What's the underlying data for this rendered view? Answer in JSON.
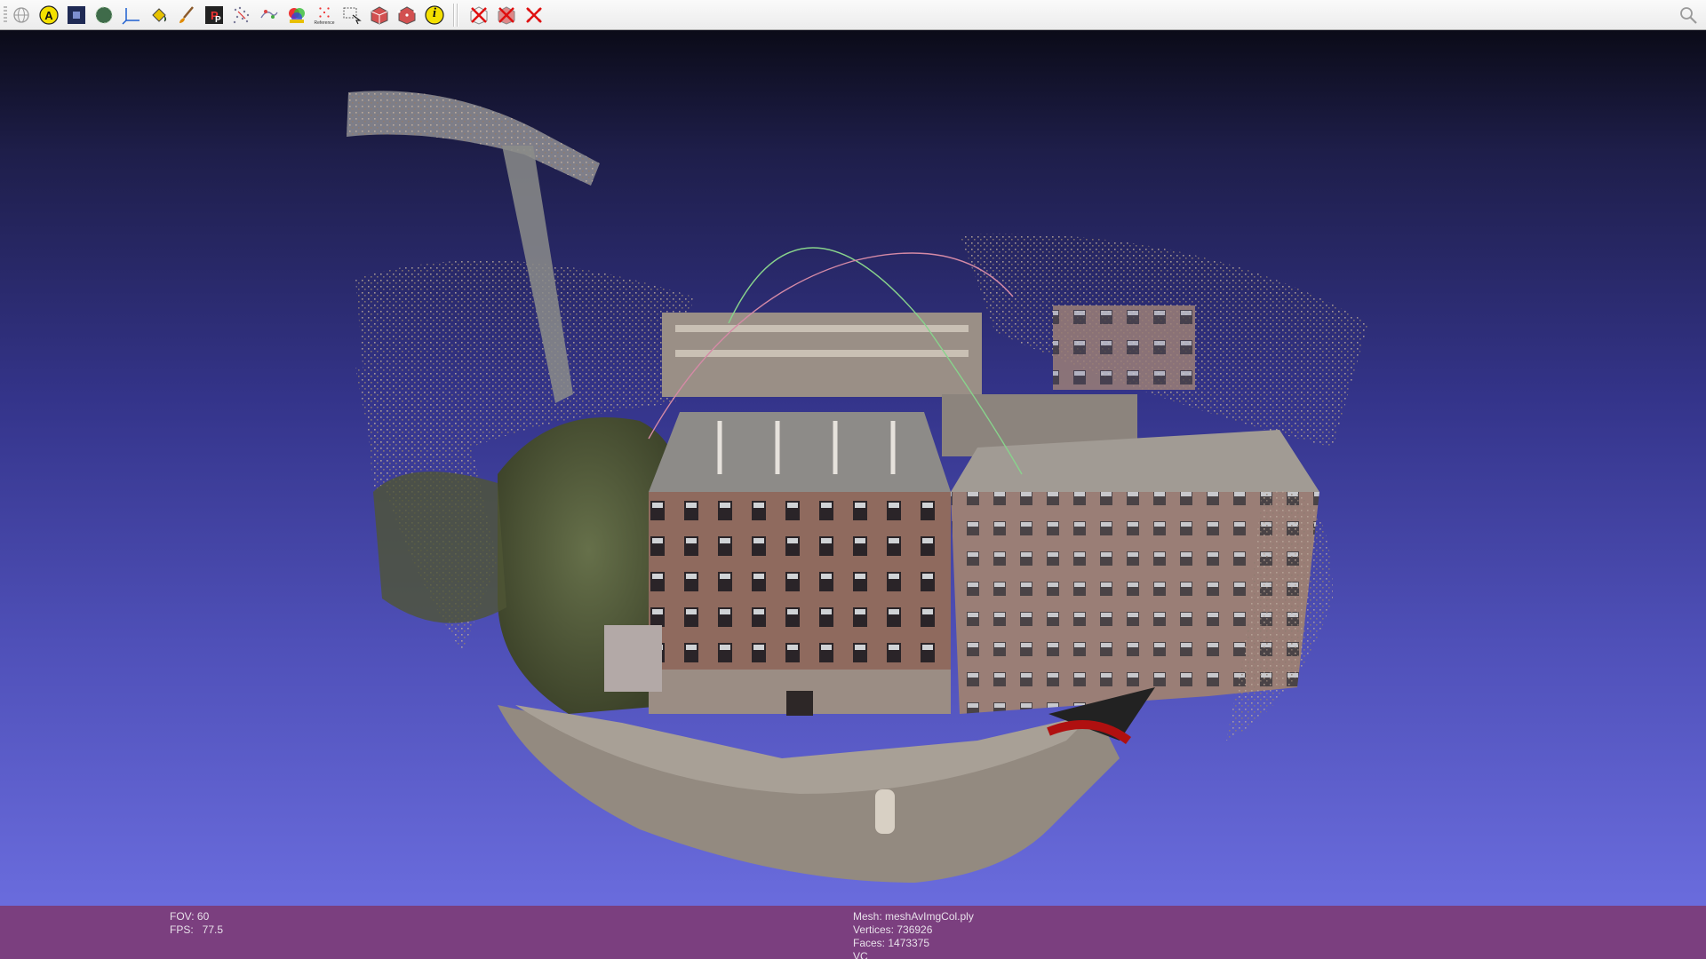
{
  "toolbar": {
    "tools": [
      {
        "name": "globe-icon"
      },
      {
        "name": "annotation-a-icon"
      },
      {
        "name": "render-mode-icon"
      },
      {
        "name": "texture-sphere-icon"
      },
      {
        "name": "axis-icon"
      },
      {
        "name": "paint-bucket-icon"
      },
      {
        "name": "brush-icon"
      },
      {
        "name": "pp-picking-icon"
      },
      {
        "name": "point-select-icon"
      },
      {
        "name": "align-points-icon"
      },
      {
        "name": "color-paint-icon"
      },
      {
        "name": "reference-icon",
        "label": "Reference"
      },
      {
        "name": "select-area-icon"
      },
      {
        "name": "select-faces-icon"
      },
      {
        "name": "select-vertices-icon"
      },
      {
        "name": "info-icon",
        "glyph": "i"
      }
    ],
    "delete_tools": [
      {
        "name": "delete-vertices-icon"
      },
      {
        "name": "delete-faces-icon"
      },
      {
        "name": "delete-selected-icon"
      }
    ],
    "search_icon": "search-icon"
  },
  "status": {
    "fov_label": "FOV: 60",
    "fps_label": "FPS:",
    "fps_value": "77.5",
    "mesh": "Mesh: meshAvImgCol.ply",
    "vertices": "Vertices: 736926",
    "faces": "Faces: 1473375",
    "vc": "VC"
  },
  "colors": {
    "status_bg": "#7b3f7f",
    "viewport_top": "#0b0b18",
    "viewport_bottom": "#6a6cdd"
  }
}
